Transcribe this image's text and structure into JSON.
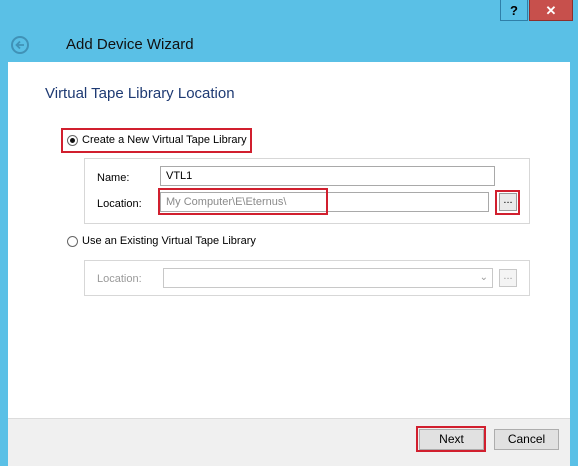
{
  "window": {
    "title": "Add Device Wizard",
    "help_label": "?",
    "close_label": "✕"
  },
  "page": {
    "section_title": "Virtual Tape Library Location"
  },
  "options": {
    "create_new": {
      "label": "Create a New Virtual Tape Library",
      "selected": true,
      "name_label": "Name:",
      "name_value": "VTL1",
      "location_label": "Location:",
      "location_value": "My Computer\\E\\Eternus\\",
      "browse_label": "..."
    },
    "use_existing": {
      "label": "Use an Existing Virtual Tape Library",
      "selected": false,
      "location_label": "Location:",
      "location_value": "",
      "browse_label": "..."
    }
  },
  "footer": {
    "next_label": "Next",
    "cancel_label": "Cancel"
  },
  "colors": {
    "titlebar": "#5ac0e6",
    "close_button": "#c7504c",
    "highlight": "#d11f2e",
    "section_title": "#1e3a73"
  }
}
